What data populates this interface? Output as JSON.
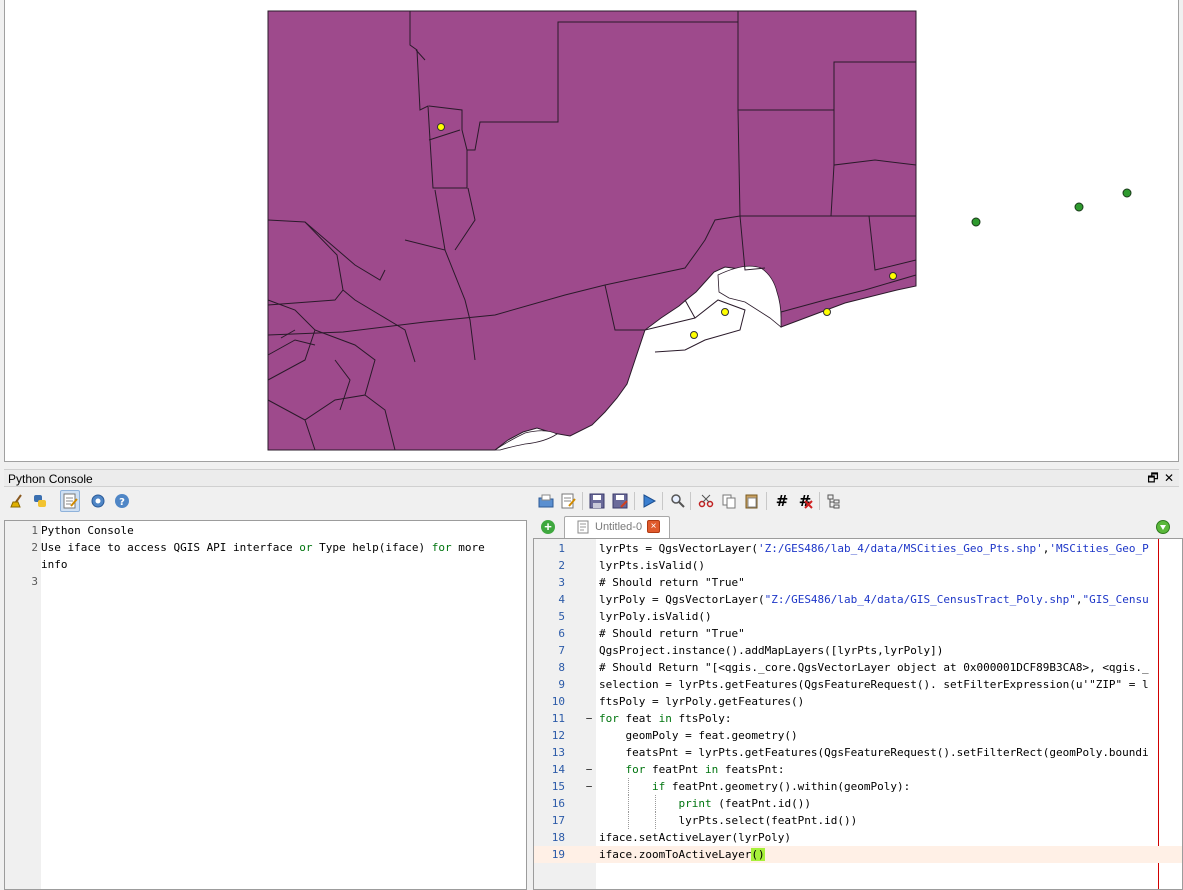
{
  "map": {
    "polygon_fill": "#9e4a8c",
    "boundary_color": "#2a1a2a",
    "yellow_point_color": "#ffff00",
    "green_point_color": "#2e9a2e"
  },
  "panel": {
    "title": "Python Console",
    "float_icon": "🗗",
    "close_icon": "✕"
  },
  "console_toolbar": [
    {
      "name": "clear-console-button",
      "icon": "broom-icon"
    },
    {
      "name": "import-class-button",
      "icon": "python-icon"
    },
    {
      "name": "show-editor-button",
      "icon": "editor-icon",
      "active": true
    },
    {
      "name": "settings-button",
      "icon": "gear-icon"
    },
    {
      "name": "help-button",
      "icon": "help-icon",
      "symbol": "?"
    }
  ],
  "editor_toolbar": [
    "open-script-icon",
    "open-in-external-editor-icon",
    "save-icon",
    "save-as-icon",
    "run-script-icon",
    "find-text-icon",
    "cut-icon",
    "copy-icon",
    "paste-icon",
    "comment-icon",
    "uncomment-icon",
    "object-inspector-icon"
  ],
  "comment_symbol": "#",
  "console": {
    "lines": [
      {
        "n": "1",
        "text": "Python Console"
      },
      {
        "n": "2",
        "text_pre": "Use iface to access QGIS API interface ",
        "kw1": "or",
        "text_mid": " Type help(iface) ",
        "kw2": "for",
        "text_post": " more"
      },
      {
        "n": "",
        "text": "info"
      },
      {
        "n": "3",
        "text": ""
      }
    ]
  },
  "editor": {
    "add_tab_icon": "+",
    "tab_label": "Untitled-0",
    "tab_close": "×",
    "lines": [
      {
        "n": "1",
        "a": "lyrPts = QgsVectorLayer(",
        "s": "'Z:/GES486/lab_4/data/MSCities_Geo_Pts.shp'",
        "b": ",",
        "s2": "'MSCities_Geo_P",
        "c": ""
      },
      {
        "n": "2",
        "a": "lyrPts.isValid()"
      },
      {
        "n": "3",
        "cmt": "# Should return \"True\""
      },
      {
        "n": "4",
        "a": "lyrPoly = QgsVectorLayer(",
        "s": "\"Z:/GES486/lab_4/data/GIS_CensusTract_Poly.shp\"",
        "b": ",",
        "s2": "\"GIS_Censu",
        "c": ""
      },
      {
        "n": "5",
        "a": "lyrPoly.isValid()"
      },
      {
        "n": "6",
        "cmt": "# Should return \"True\""
      },
      {
        "n": "7",
        "a": "QgsProject.instance().addMapLayers([lyrPts,lyrPoly])"
      },
      {
        "n": "8",
        "cmt": "# Should Return \"[<qgis._core.QgsVectorLayer object at 0x000001DCF89B3CA8>, <qgis._"
      },
      {
        "n": "9",
        "a": "selection = lyrPts.getFeatures(QgsFeatureRequest(). setFilterExpression(u'\"ZIP\" = l"
      },
      {
        "n": "10",
        "a": "ftsPoly = lyrPoly.getFeatures()"
      },
      {
        "n": "11",
        "kw": "for",
        "a": " feat ",
        "kw2": "in",
        "a2": " ftsPoly:",
        "fold": "−"
      },
      {
        "n": "12",
        "a": "    geomPoly = feat.geometry()"
      },
      {
        "n": "13",
        "a": "    featsPnt = lyrPts.getFeatures(QgsFeatureRequest().setFilterRect(geomPoly.boundi"
      },
      {
        "n": "14",
        "pre": "    ",
        "kw": "for",
        "a": " featPnt ",
        "kw2": "in",
        "a2": " featsPnt:",
        "fold": "−"
      },
      {
        "n": "15",
        "pre": "        ",
        "kw": "if",
        "a": " featPnt.geometry().within(geomPoly):",
        "fold": "−"
      },
      {
        "n": "16",
        "pre": "            ",
        "kw": "print",
        "a": " (featPnt.id())"
      },
      {
        "n": "17",
        "a": "            lyrPts.select(featPnt.id())"
      },
      {
        "n": "18",
        "a": "iface.setActiveLayer(lyrPoly)"
      },
      {
        "n": "19",
        "a": "iface.zoomToActiveLayer",
        "brace": "()"
      }
    ]
  }
}
